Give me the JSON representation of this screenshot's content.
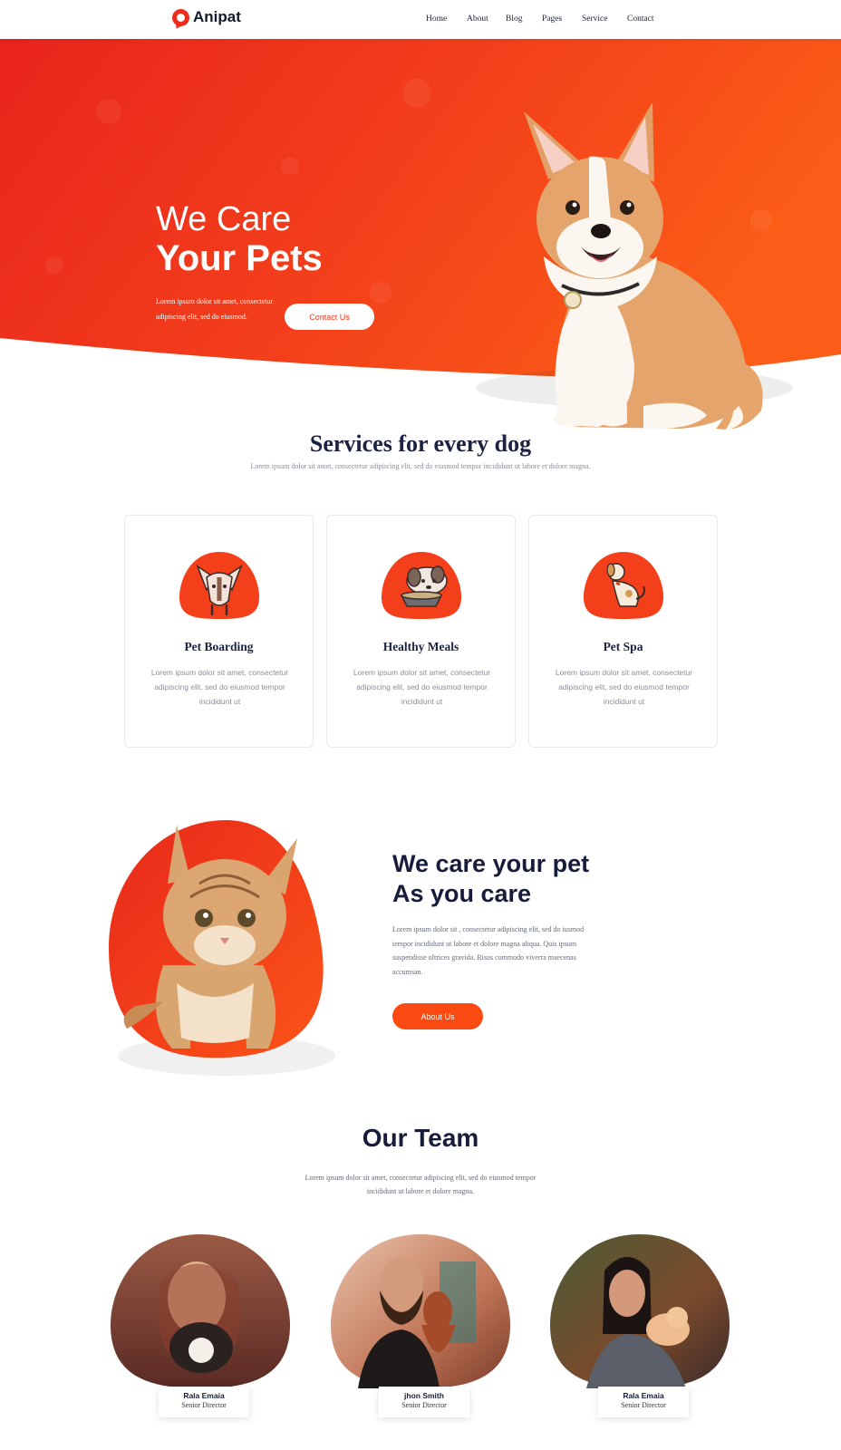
{
  "nav": {
    "logo_text": "Anipat",
    "items": [
      "Home",
      "About",
      "Blog",
      "Pages",
      "Service",
      "Contact"
    ]
  },
  "hero": {
    "title_line1": "We Care",
    "title_line2": "Your Pets",
    "description": "Lorem ipsum dolor sit amet, consectetur adipiscing elit, sed do eiusmod.",
    "cta_label": "Contact Us"
  },
  "services": {
    "title": "Services for every dog",
    "subtitle": "Lorem ipsum dolor sit amet, consectetur adipiscing elit, sed do eiusmod tempor incididunt ut labore et dolore magna.",
    "cards": [
      {
        "title": "Pet Boarding",
        "text": "Lorem ipsum dolor sit amet, consectetur adipiscing elit, sed do eiusmod tempor incididunt ut",
        "icon": "chihuahua-icon"
      },
      {
        "title": "Healthy Meals",
        "text": "Lorem ipsum dolor sit amet, consectetur adipiscing elit, sed do eiusmod tempor incididunt ut",
        "icon": "dog-bowl-icon"
      },
      {
        "title": "Pet Spa",
        "text": "Lorem ipsum dolor sit amet, consectetur adipiscing elit, sed do eiusmod tempor incididunt ut",
        "icon": "sitting-dog-icon"
      }
    ]
  },
  "about": {
    "title_line1": "We care your pet",
    "title_line2": "As you care",
    "text": "Lorem ipsum dolor sit , consectetur adipiscing elit, sed do iusmod tempor incididunt ut labore et dolore magna aliqua. Quis ipsum suspendisse ultrices gravida. Risus commodo viverra maecenas accumsan.",
    "cta_label": "About Us"
  },
  "team": {
    "title": "Our Team",
    "subtitle": "Lorem ipsum dolor sit amet, consectetur adipiscing elit, sed do eiusmod tempor incididunt ut labore et dolore magna.",
    "members": [
      {
        "name": "Rala Emaia",
        "role": "Senior Director"
      },
      {
        "name": "jhon Smith",
        "role": "Senior Director"
      },
      {
        "name": "Rala Emaia",
        "role": "Senior Director"
      }
    ]
  },
  "colors": {
    "accent": "#fb4a12",
    "hero_red": "#ee2d1f",
    "navy": "#161c3a"
  }
}
